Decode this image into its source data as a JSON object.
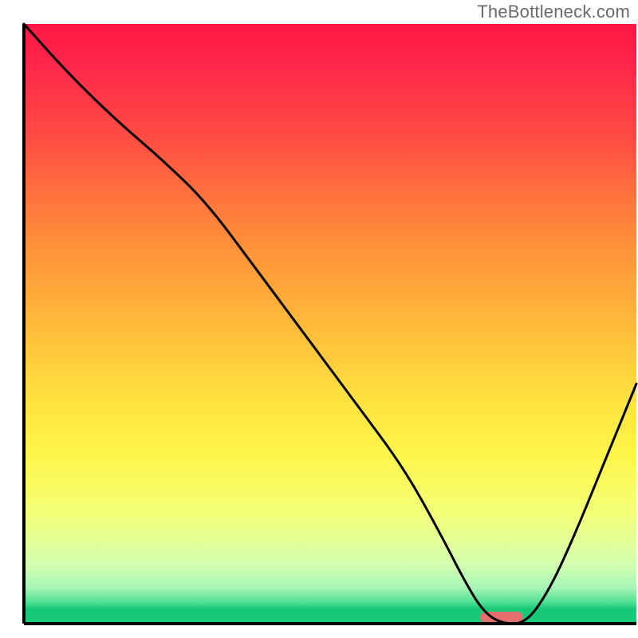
{
  "watermark": "TheBottleneck.com",
  "chart_data": {
    "type": "line",
    "title": "",
    "xlabel": "",
    "ylabel": "",
    "xlim": [
      0,
      100
    ],
    "ylim": [
      0,
      100
    ],
    "gradient_stops": [
      {
        "offset": 0.0,
        "color": "#ff1744"
      },
      {
        "offset": 0.08,
        "color": "#ff2a4a"
      },
      {
        "offset": 0.2,
        "color": "#ff5042"
      },
      {
        "offset": 0.35,
        "color": "#ff8a3a"
      },
      {
        "offset": 0.5,
        "color": "#ffb93a"
      },
      {
        "offset": 0.62,
        "color": "#ffe040"
      },
      {
        "offset": 0.72,
        "color": "#fff64a"
      },
      {
        "offset": 0.82,
        "color": "#f3ff7a"
      },
      {
        "offset": 0.9,
        "color": "#d4ffb0"
      },
      {
        "offset": 0.94,
        "color": "#a8f5b8"
      },
      {
        "offset": 0.965,
        "color": "#4be090"
      },
      {
        "offset": 0.975,
        "color": "#18c977"
      },
      {
        "offset": 1.0,
        "color": "#18c977"
      }
    ],
    "series": [
      {
        "name": "bottleneck-curve",
        "x": [
          0,
          7,
          15,
          23,
          30,
          38,
          46,
          54,
          62,
          68,
          72,
          75,
          78,
          82,
          86,
          90,
          94,
          98,
          100
        ],
        "values": [
          100,
          92,
          84,
          77,
          70,
          59,
          48,
          37,
          26,
          15,
          7,
          2,
          0,
          0,
          6,
          15,
          25,
          35,
          40
        ]
      }
    ],
    "flat_segment": {
      "x_start": 73,
      "x_end": 82,
      "value": 0
    },
    "marker": {
      "name": "target-marker",
      "x_center": 78,
      "width": 7,
      "color": "#e76e6e"
    },
    "axis": {
      "left_x": 3,
      "bottom_y": 0,
      "plot_top": 3,
      "plot_right": 100
    }
  }
}
